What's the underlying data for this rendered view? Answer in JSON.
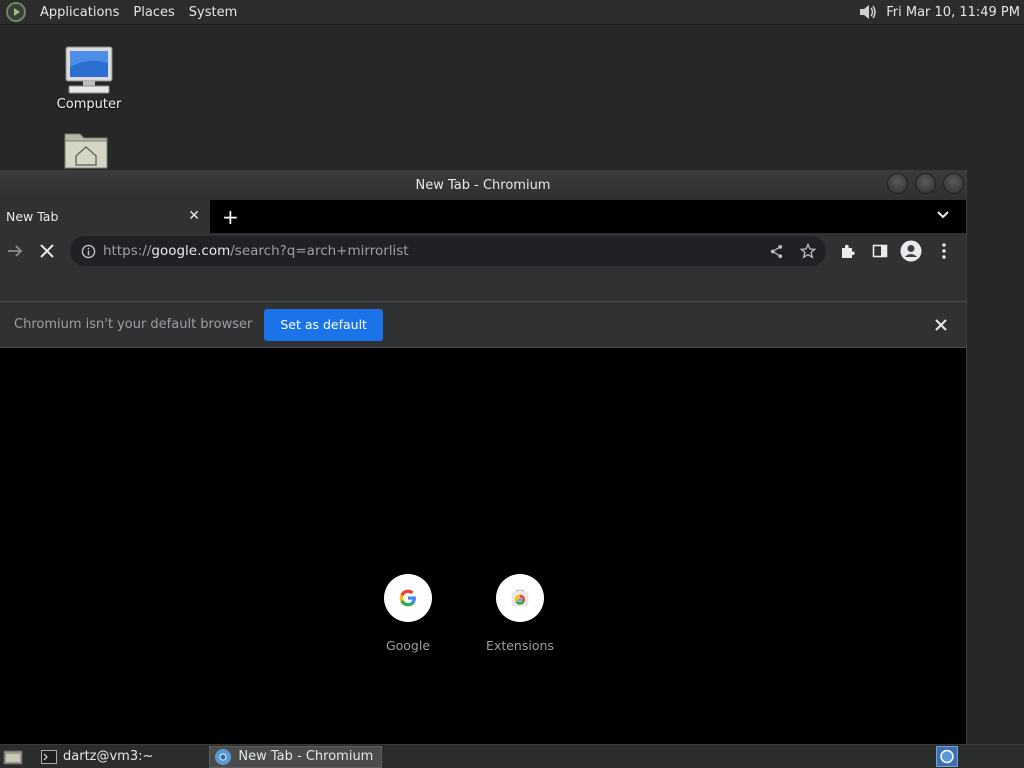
{
  "top_panel": {
    "menus": [
      "Applications",
      "Places",
      "System"
    ],
    "clock": "Fri Mar 10, 11:49 PM"
  },
  "desktop": {
    "icons": [
      {
        "label": "Computer",
        "icon": "computer-icon"
      },
      {
        "label": "",
        "icon": "home-folder-icon"
      }
    ]
  },
  "window": {
    "title": "New Tab - Chromium",
    "tab": {
      "label": "New Tab"
    },
    "omnibox": {
      "url_prefix": "https://",
      "url_host": "google.com",
      "url_rest": "/search?q=arch+mirrorlist"
    },
    "infobar": {
      "text": "Chromium isn't your default browser",
      "button": "Set as default"
    },
    "shortcuts": [
      {
        "label": "Google",
        "icon": "google-g-icon"
      },
      {
        "label": "Extensions",
        "icon": "chrome-web-store-icon"
      }
    ]
  },
  "taskbar": {
    "tasks": [
      {
        "label": "dartz@vm3:~",
        "icon": "terminal-icon",
        "active": false
      },
      {
        "label": "New Tab - Chromium",
        "icon": "chromium-icon",
        "active": true
      }
    ]
  },
  "colors": {
    "accent_button": "#1a73e8",
    "toolbar_bg": "#2f3132",
    "desktop_bg": "#262828"
  }
}
